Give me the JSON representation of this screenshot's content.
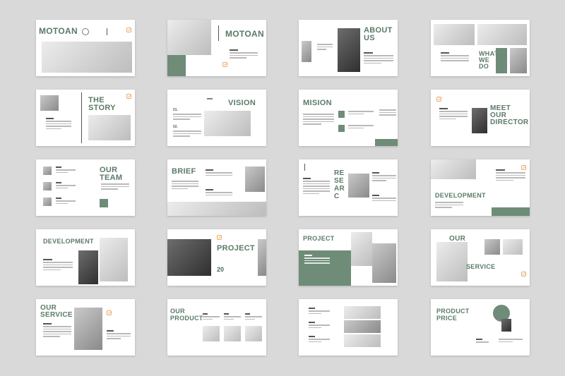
{
  "slides": [
    {
      "title": "MOTOAN"
    },
    {
      "title": "MOTOAN"
    },
    {
      "title": "ABOUT\nUS"
    },
    {
      "title": "WHAT\nWE\nDO"
    },
    {
      "title": "THE\nSTORY"
    },
    {
      "title": "VISION"
    },
    {
      "title": "MISION"
    },
    {
      "title": "MEET\nOUR\nDIRECTOR"
    },
    {
      "title": "OUR\nTEAM"
    },
    {
      "title": "BRIEF"
    },
    {
      "title": "RE\nSE\nAR\nC"
    },
    {
      "title": "DEVELOPMENT"
    },
    {
      "title": "DEVELOPMENT"
    },
    {
      "title": "PROJECT",
      "number": "20"
    },
    {
      "title": "PROJECT"
    },
    {
      "title": "OUR",
      "title2": "SERVICE"
    },
    {
      "title": "OUR\nSERVICE"
    },
    {
      "title": "OUR\nPRODUCT"
    },
    {
      "title": ""
    },
    {
      "title": "PRODUCT\nPRICE"
    }
  ],
  "colors": {
    "accent": "#6e8c78",
    "logo": "#e8a86a",
    "background": "#d9d9d9"
  }
}
